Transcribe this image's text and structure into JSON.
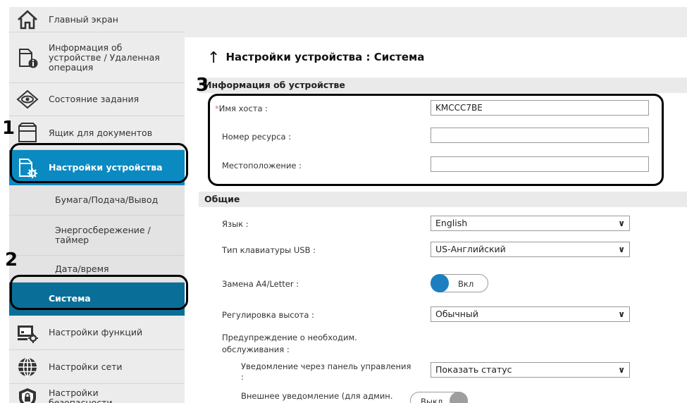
{
  "sidebar": {
    "items": [
      {
        "label": "Главный экран",
        "icon": "home-icon"
      },
      {
        "label": "Информация об\nустройстве / Удаленная\nоперация",
        "icon": "device-info-icon"
      },
      {
        "label": "Состояние задания",
        "icon": "job-status-icon"
      },
      {
        "label": "Ящик для документов",
        "icon": "document-box-icon"
      },
      {
        "label": "Настройки устройства",
        "icon": "device-settings-icon"
      },
      {
        "label": "Бумага/Подача/Вывод"
      },
      {
        "label": "Энергосбережение /\nтаймер"
      },
      {
        "label": "Дата/время"
      },
      {
        "label": "Система"
      },
      {
        "label": "Настройки функций",
        "icon": "function-settings-icon"
      },
      {
        "label": "Настройки сети",
        "icon": "network-icon"
      },
      {
        "label": "Настройки\nбезопасности",
        "icon": "security-icon"
      }
    ]
  },
  "page": {
    "title": "Настройки устройства : Система"
  },
  "device_info": {
    "header": "Информация об устройстве",
    "required_mark": "*",
    "hostname_label": "Имя хоста :",
    "hostname_value": "KMCCC7BE",
    "asset_label": "Номер ресурса :",
    "asset_value": "",
    "location_label": "Местоположение :",
    "location_value": ""
  },
  "general": {
    "header": "Общие",
    "language_label": "Язык :",
    "language_value": "English",
    "usb_keyboard_label": "Тип клавиатуры USB :",
    "usb_keyboard_value": "US-Английский",
    "a4_letter_label": "Замена A4/Letter :",
    "a4_letter_value": "Вкл",
    "altitude_label": "Регулировка высота :",
    "altitude_value": "Обычный",
    "maintenance_label": "Предупреждение о необходим.\nобслуживания :",
    "panel_notify_label": "Уведомление через панель управления\n:",
    "panel_notify_value": "Показать статус",
    "external_notify_label": "Внешнее уведомление (для админ.",
    "external_notify_value": "Выкл"
  },
  "callouts": {
    "one": "1",
    "two": "2",
    "three": "3"
  },
  "colors": {
    "accent": "#0b8ac2",
    "active_sub": "#0a6f98",
    "sidebar_bg": "#ececec"
  }
}
